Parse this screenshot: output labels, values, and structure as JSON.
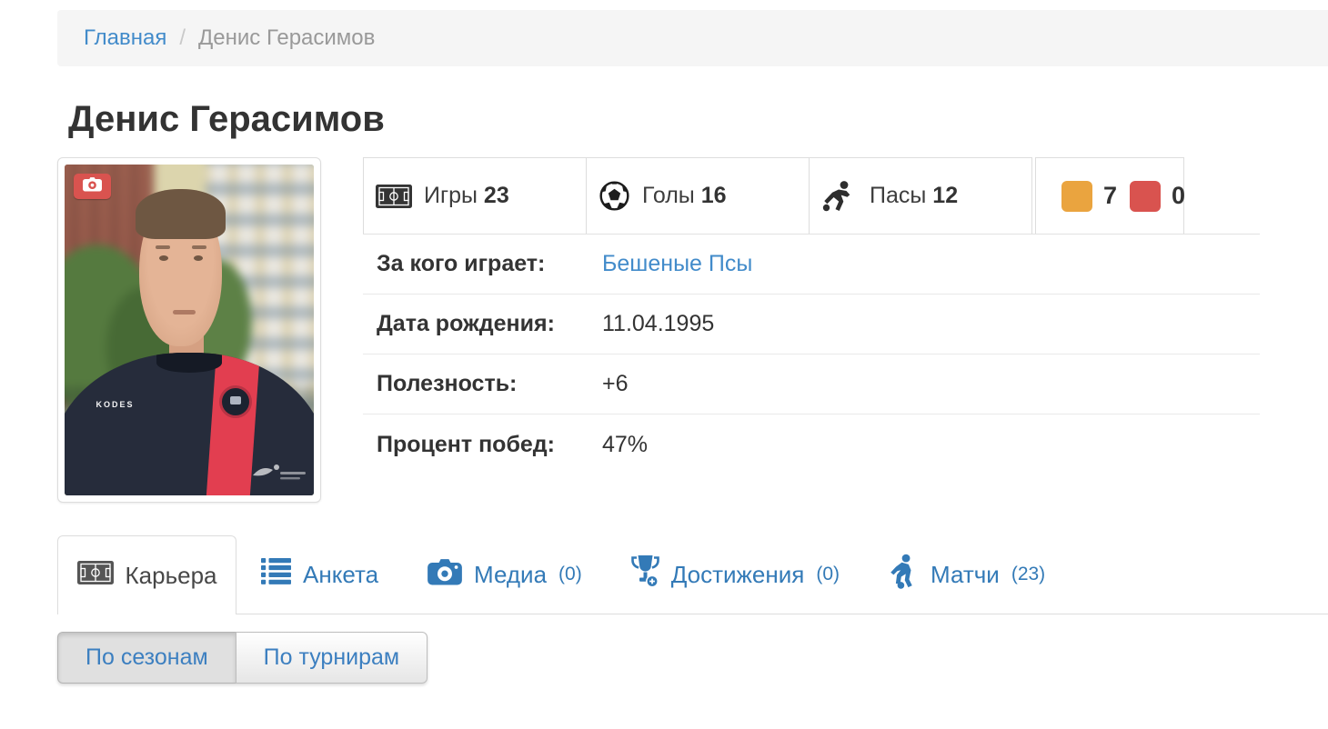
{
  "breadcrumb": {
    "home": "Главная",
    "separator": "/",
    "current": "Денис Герасимов"
  },
  "page_title": "Денис Герасимов",
  "photo": {
    "shirt_brand": "KODES"
  },
  "stats": {
    "games": {
      "label": "Игры",
      "value": "23"
    },
    "goals": {
      "label": "Голы",
      "value": "16"
    },
    "assists": {
      "label": "Пасы",
      "value": "12"
    },
    "yellow_cards": {
      "value": "7",
      "color": "#eaa43f"
    },
    "red_cards": {
      "value": "0",
      "color": "#d9534f"
    }
  },
  "info": {
    "rows": [
      {
        "label": "За кого играет:",
        "value": "Бешеные Псы"
      },
      {
        "label": "Дата рождения:",
        "value": "11.04.1995"
      },
      {
        "label": "Полезность:",
        "value": "+6"
      },
      {
        "label": "Процент побед:",
        "value": "47%"
      }
    ]
  },
  "tabs": [
    {
      "label": "Карьера",
      "active": true
    },
    {
      "label": "Анкета"
    },
    {
      "label": "Медиа",
      "count": "(0)"
    },
    {
      "label": "Достижения",
      "count": "(0)"
    },
    {
      "label": "Матчи",
      "count": "(23)"
    }
  ],
  "view_toggle": {
    "by_seasons": "По сезонам",
    "by_tournaments": "По турнирам"
  },
  "colors": {
    "link_blue": "#428bca",
    "tab_blue": "#337ab7",
    "yellow_card": "#eaa43f",
    "red_card": "#d9534f",
    "badge_red": "#d9534f"
  }
}
